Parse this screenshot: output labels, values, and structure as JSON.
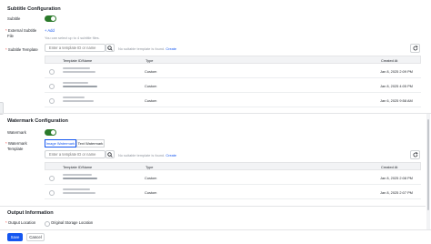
{
  "subtitle": {
    "section_title": "Subtitle Configuration",
    "subtitle_label": "Subtitle",
    "external_file_label_line1": "External Subtitle",
    "external_file_label_line2": "File",
    "add_label": "Add",
    "files_hint": "You can select up to 4 subtitle files.",
    "template_label": "Subtitle Template",
    "search_placeholder": "Enter a template ID or name",
    "not_found_text": "No suitable template is found.",
    "create_label": "Create",
    "table": {
      "columns": [
        "Template ID/Name",
        "Type",
        "Created At"
      ],
      "rows": [
        {
          "type": "Custom",
          "created": "Jan 8, 2025 2:09 PM"
        },
        {
          "type": "Custom",
          "created": "Jan 8, 2025 4:05 PM"
        },
        {
          "type": "Custom",
          "created": "Jan 6, 2025 9:58 AM"
        }
      ]
    }
  },
  "watermark": {
    "section_title": "Watermark Configuration",
    "watermark_label": "Watermark",
    "template_label_line1": "Watermark",
    "template_label_line2": "Template",
    "tab_image": "Image Watermark",
    "tab_text": "Text Watermark",
    "search_placeholder": "Enter a template ID or name",
    "not_found_text": "No suitable template is found.",
    "create_label": "Create",
    "table": {
      "columns": [
        "Template ID/Name",
        "Type",
        "Created At"
      ],
      "rows": [
        {
          "type": "Custom",
          "created": "Jan 8, 2025 2:08 PM"
        },
        {
          "type": "Custom",
          "created": "Jan 8, 2025 2:07 PM"
        }
      ]
    }
  },
  "output": {
    "section_title": "Output Information",
    "location_label": "Output Location",
    "location_option": "Original Storage Location"
  },
  "footer": {
    "save_label": "Save",
    "cancel_label": "Cancel"
  }
}
